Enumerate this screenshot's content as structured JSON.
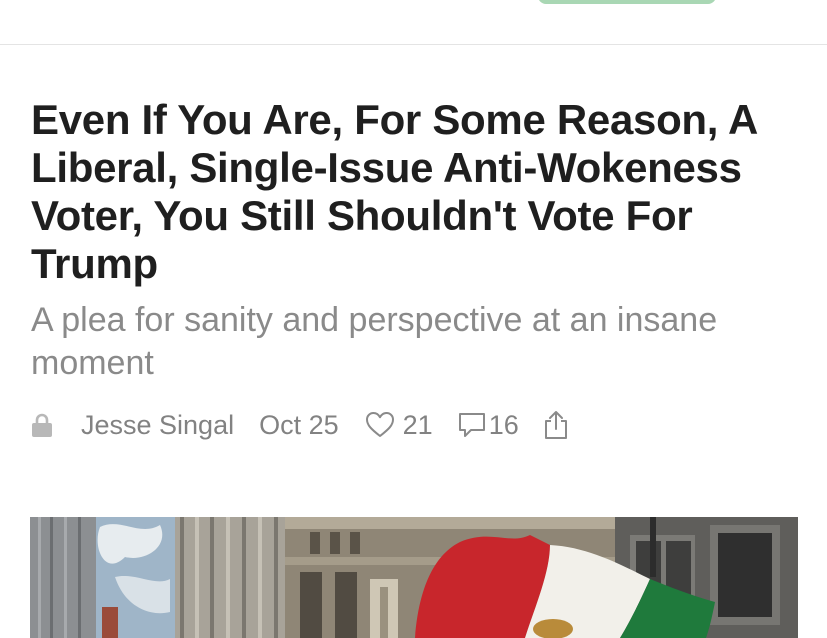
{
  "header": {
    "button_color": "#a9d7b4"
  },
  "post": {
    "title": "Even If You Are, For Some Reason, A Liberal, Single-Issue Anti-Wokeness Voter, You Still Shouldn't Vote For Trump",
    "subtitle": "A plea for sanity and perspective at an insane moment",
    "author": "Jesse Singal",
    "date": "Oct 25",
    "likes": "21",
    "comments": "16",
    "icons": {
      "lock": "lock-icon",
      "like": "heart-icon",
      "comment": "comment-icon",
      "share": "share-icon"
    }
  },
  "hero_image": {
    "subject": "mexican-flag-waved-among-city-buildings",
    "colors": {
      "flag_red": "#c8262c",
      "flag_white": "#f2f0ea",
      "flag_green": "#1f7a3c"
    }
  }
}
